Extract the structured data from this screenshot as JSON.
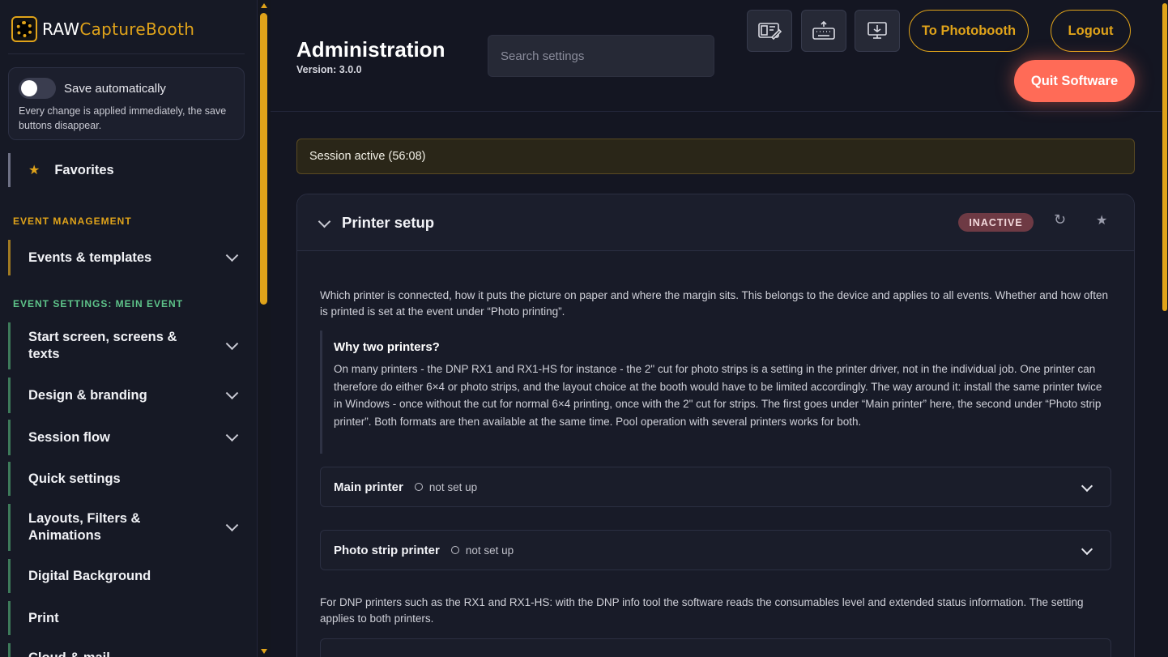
{
  "app": {
    "logo_raw": "RAW",
    "logo_rest": "CaptureBooth"
  },
  "sidebar": {
    "autosave": {
      "title": "Save automatically",
      "description": "Every change is applied immediately, the save buttons disappear."
    },
    "favorites_label": "Favorites",
    "section_event_management": "EVENT MANAGEMENT",
    "events_templates": "Events & templates",
    "section_event_settings": "EVENT SETTINGS: MEIN EVENT",
    "items": [
      "Start screen, screens & texts",
      "Design & branding",
      "Session flow",
      "Quick settings",
      "Layouts, Filters & Animations",
      "Digital Background",
      "Print",
      "Cloud & mail"
    ]
  },
  "header": {
    "title": "Administration",
    "version": "Version: 3.0.0",
    "search_placeholder": "Search settings",
    "to_photobooth": "To Photobooth",
    "logout": "Logout",
    "quit": "Quit Software"
  },
  "session": {
    "text": "Session active (56:08)"
  },
  "printer_card": {
    "title": "Printer setup",
    "badge": "INACTIVE",
    "intro": "Which printer is connected, how it puts the picture on paper and where the margin sits. This belongs to the device and applies to all events. Whether and how often is printed is set at the event under “Photo printing”.",
    "why_title": "Why two printers?",
    "why_text": "On many printers - the DNP RX1 and RX1-HS for instance - the 2\" cut for photo strips is a setting in the printer driver, not in the individual job. One printer can therefore do either 6×4 or photo strips, and the layout choice at the booth would have to be limited accordingly. The way around it: install the same printer twice in Windows - once without the cut for normal 6×4 printing, once with the 2\" cut for strips. The first goes under “Main printer” here, the second under “Photo strip printer”. Both formats are then available at the same time. Pool operation with several printers works for both.",
    "main_printer": "Main printer",
    "main_printer_status": "not set up",
    "strip_printer": "Photo strip printer",
    "strip_printer_status": "not set up",
    "dnp_text": "For DNP printers such as the RX1 and RX1-HS: with the DNP info tool the software reads the consumables level and extended status information. The setting applies to both printers."
  }
}
